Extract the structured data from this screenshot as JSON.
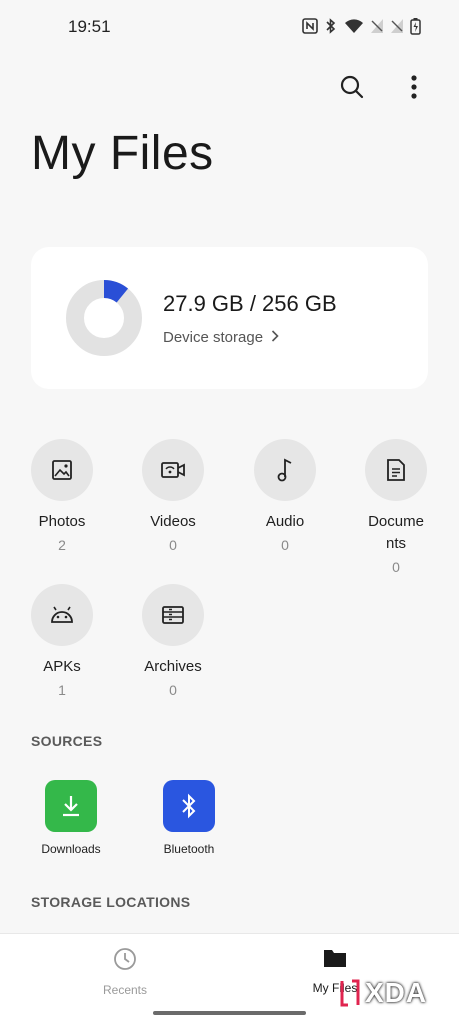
{
  "status_bar": {
    "time": "19:51",
    "icons": [
      "nfc-icon",
      "bluetooth-icon",
      "wifi-icon",
      "signal-icon",
      "signal-icon",
      "battery-charging-icon"
    ]
  },
  "header": {
    "title": "My Files",
    "actions": [
      "search-icon",
      "more-options-icon"
    ]
  },
  "storage": {
    "used_text": "27.9 GB / 256 GB",
    "used_fraction": 0.109,
    "link_label": "Device storage",
    "accent_color": "#2a4fd6",
    "track_color": "#e2e2e2"
  },
  "categories": [
    {
      "label": "Photos",
      "count": "2",
      "icon": "image-icon"
    },
    {
      "label": "Videos",
      "count": "0",
      "icon": "video-icon"
    },
    {
      "label": "Audio",
      "count": "0",
      "icon": "music-note-icon"
    },
    {
      "label_line1": "Docume",
      "label_line2": "nts",
      "count": "0",
      "icon": "document-icon"
    },
    {
      "label": "APKs",
      "count": "1",
      "icon": "android-icon"
    },
    {
      "label": "Archives",
      "count": "0",
      "icon": "archive-icon"
    }
  ],
  "sources": {
    "heading": "SOURCES",
    "items": [
      {
        "label": "Downloads",
        "icon": "download-icon",
        "color": "#34b84a"
      },
      {
        "label": "Bluetooth",
        "icon": "bluetooth-icon",
        "color": "#2a56e0"
      }
    ]
  },
  "storage_locations": {
    "heading": "STORAGE LOCATIONS"
  },
  "bottom_nav": {
    "items": [
      {
        "label": "Recents",
        "icon": "clock-icon",
        "active": false
      },
      {
        "label": "My Files",
        "icon": "folder-icon",
        "active": true
      }
    ]
  },
  "watermark": {
    "text": "XDA"
  }
}
